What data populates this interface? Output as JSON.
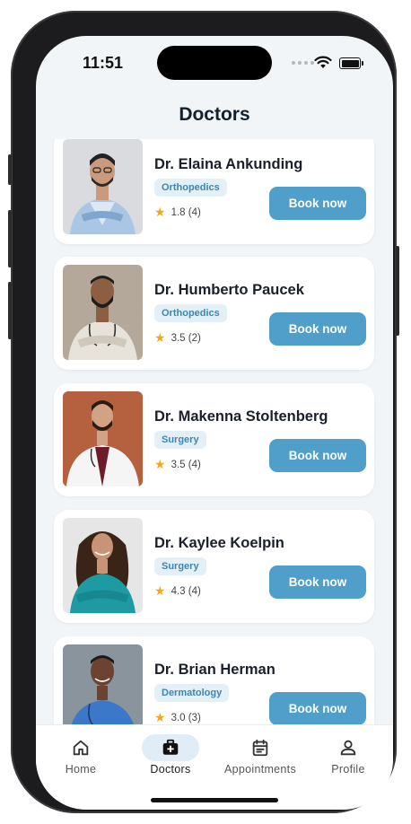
{
  "status_bar": {
    "time": "11:51"
  },
  "header": {
    "title": "Doctors"
  },
  "doctors": [
    {
      "name": "Dr. Elaina Ankunding",
      "specialty": "Orthopedics",
      "rating": "1.8 (4)",
      "book_label": "Book now"
    },
    {
      "name": "Dr. Humberto Paucek",
      "specialty": "Orthopedics",
      "rating": "3.5 (2)",
      "book_label": "Book now"
    },
    {
      "name": "Dr. Makenna Stoltenberg",
      "specialty": "Surgery",
      "rating": "3.5 (4)",
      "book_label": "Book now"
    },
    {
      "name": "Dr. Kaylee Koelpin",
      "specialty": "Surgery",
      "rating": "4.3 (4)",
      "book_label": "Book now"
    },
    {
      "name": "Dr. Brian Herman",
      "specialty": "Dermatology",
      "rating": "3.0 (3)",
      "book_label": "Book now"
    }
  ],
  "tabs": [
    {
      "label": "Home",
      "icon": "home-icon"
    },
    {
      "label": "Doctors",
      "icon": "medical-bag-icon",
      "active": true
    },
    {
      "label": "Appointments",
      "icon": "calendar-icon"
    },
    {
      "label": "Profile",
      "icon": "person-icon"
    }
  ],
  "colors": {
    "accent": "#4f9fca",
    "tag_bg": "#e4f0f7",
    "star": "#f2a81d",
    "background": "#f1f5f8"
  }
}
